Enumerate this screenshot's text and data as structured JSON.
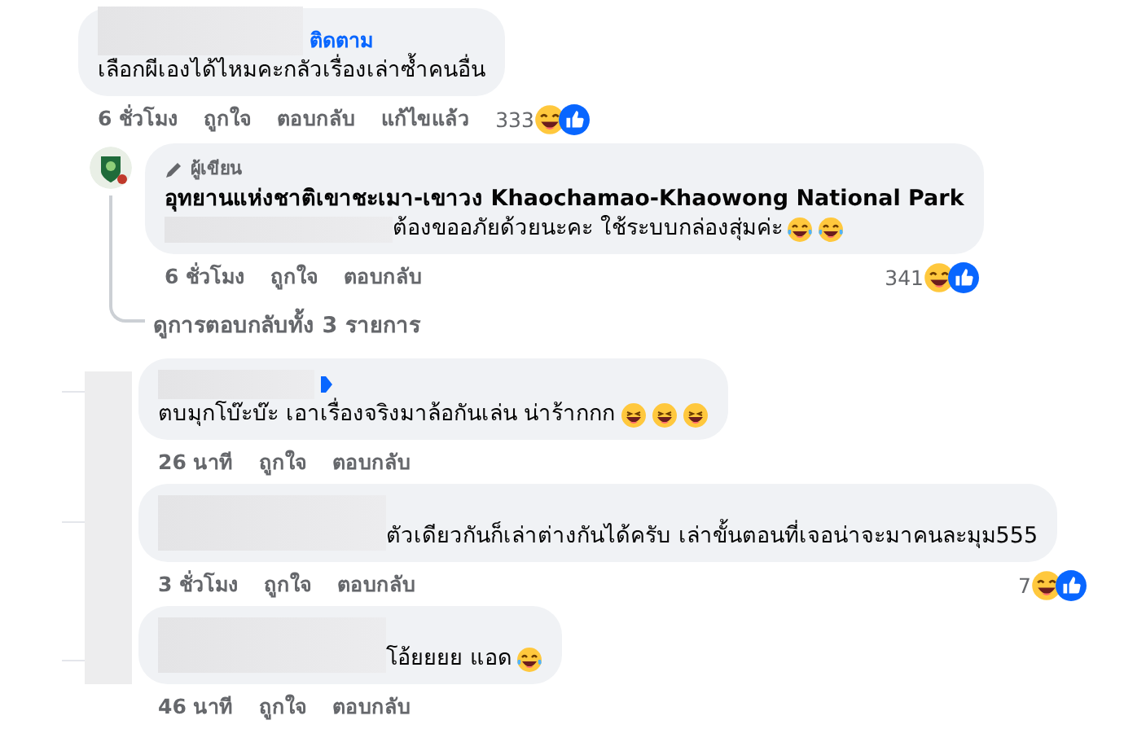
{
  "comments": [
    {
      "kind": "top",
      "follow": "ติดตาม",
      "text": "เลือกผีเองได้ไหมคะกลัวเรื่องเล่าซ้ำคนอื่น",
      "actions": [
        "6 ชั่วโมง",
        "ถูกใจ",
        "ตอบกลับ",
        "แก้ไขแล้ว"
      ],
      "reaction_count": "333",
      "reactions": [
        {
          "kind": "haha"
        },
        {
          "kind": "like"
        }
      ]
    },
    {
      "kind": "author",
      "badge": "ผู้เขียน",
      "author": "อุทยานแห่งชาติเขาชะเมา-เขาวง Khaochamao-Khaowong National Park",
      "text": "ต้องขออภัยด้วยนะคะ ใช้ระบบกล่องสุ่มค่ะ",
      "emojis": [
        {
          "kind": "rofl"
        },
        {
          "kind": "rofl"
        }
      ],
      "actions": [
        "6 ชั่วโมง",
        "ถูกใจ",
        "ตอบกลับ"
      ],
      "reaction_count": "341",
      "reactions": [
        {
          "kind": "haha"
        },
        {
          "kind": "like"
        }
      ],
      "view_replies": "ดูการตอบกลับทั้ง 3 รายการ"
    },
    {
      "kind": "reply",
      "verified": true,
      "text": "ตบมุกโบ๊ะบ๊ะ เอาเรื่องจริงมาล้อกันเล่น น่าร้ากกก",
      "emojis": [
        {
          "kind": "grin"
        },
        {
          "kind": "grin"
        },
        {
          "kind": "grin"
        }
      ],
      "actions": [
        "26 นาที",
        "ถูกใจ",
        "ตอบกลับ"
      ]
    },
    {
      "kind": "inlinereply",
      "text": "ตัวเดียวกันก็เล่าต่างกันได้ครับ เล่าขั้นตอนที่เจอน่าจะมาคนละมุม555",
      "actions": [
        "3 ชั่วโมง",
        "ถูกใจ",
        "ตอบกลับ"
      ],
      "reaction_count": "7",
      "reactions": [
        {
          "kind": "haha"
        },
        {
          "kind": "like"
        }
      ]
    },
    {
      "kind": "inlinereply",
      "text": "โอ้ยยยย แอด",
      "emojis": [
        {
          "kind": "tears"
        }
      ],
      "actions": [
        "46 นาที",
        "ถูกใจ",
        "ตอบกลับ"
      ]
    }
  ]
}
